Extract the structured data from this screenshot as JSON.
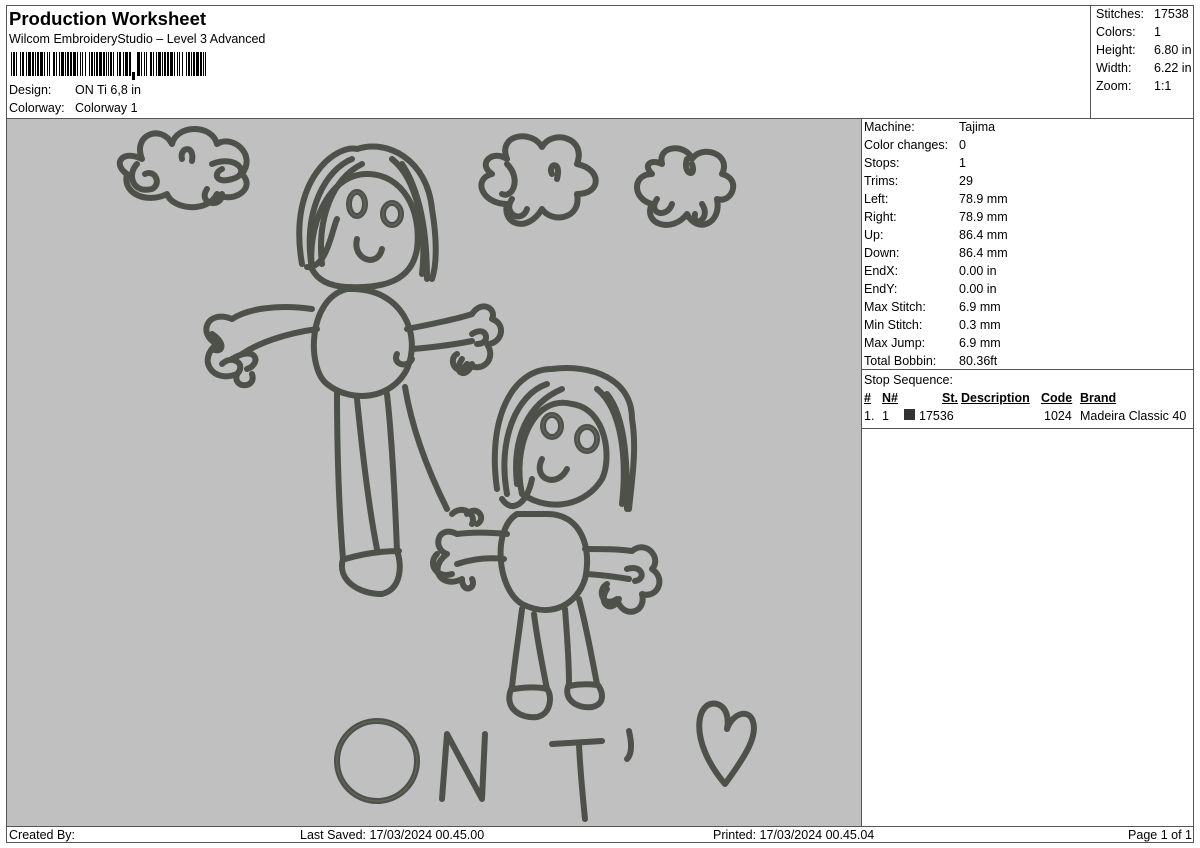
{
  "header": {
    "title": "Production Worksheet",
    "subtitle": "Wilcom EmbroideryStudio – Level 3 Advanced",
    "design_label": "Design:",
    "design_value": "ON Ti 6,8 in",
    "colorway_label": "Colorway:",
    "colorway_value": "Colorway 1"
  },
  "summary": {
    "stitches_label": "Stitches:",
    "stitches_value": "17538",
    "colors_label": "Colors:",
    "colors_value": "1",
    "height_label": "Height:",
    "height_value": "6.80 in",
    "width_label": "Width:",
    "width_value": "6.22 in",
    "zoom_label": "Zoom:",
    "zoom_value": "1:1"
  },
  "machine_info": [
    {
      "label": "Machine:",
      "value": "Tajima"
    },
    {
      "label": "Color changes:",
      "value": "0"
    },
    {
      "label": "Stops:",
      "value": "1"
    },
    {
      "label": "Trims:",
      "value": "29"
    },
    {
      "label": "Left:",
      "value": "78.9 mm"
    },
    {
      "label": "Right:",
      "value": "78.9 mm"
    },
    {
      "label": "Up:",
      "value": "86.4 mm"
    },
    {
      "label": "Down:",
      "value": "86.4 mm"
    },
    {
      "label": "EndX:",
      "value": "0.00 in"
    },
    {
      "label": "EndY:",
      "value": "0.00 in"
    },
    {
      "label": "Max Stitch:",
      "value": "6.9 mm"
    },
    {
      "label": "Min Stitch:",
      "value": "0.3 mm"
    },
    {
      "label": "Max Jump:",
      "value": "6.9 mm"
    },
    {
      "label": "Total Bobbin:",
      "value": "80.36ft"
    }
  ],
  "stop_sequence": {
    "title": "Stop Sequence:",
    "columns": {
      "idx": "#",
      "n": "N#",
      "st": "St.",
      "description": "Description",
      "code": "Code",
      "brand": "Brand"
    },
    "rows": [
      {
        "idx": "1.",
        "n": "1",
        "st": "17536",
        "description": "",
        "code": "1024",
        "brand": "Madeira Classic 40",
        "color": "#333333"
      }
    ]
  },
  "footer": {
    "created_by": "Created By:",
    "last_saved": "Last Saved: 17/03/2024 00.45.00",
    "printed": "Printed: 17/03/2024 00.45.04",
    "page": "Page 1 of 1"
  },
  "colors": {
    "design_background": "#c0c0c0",
    "thread": "#4e514a"
  }
}
